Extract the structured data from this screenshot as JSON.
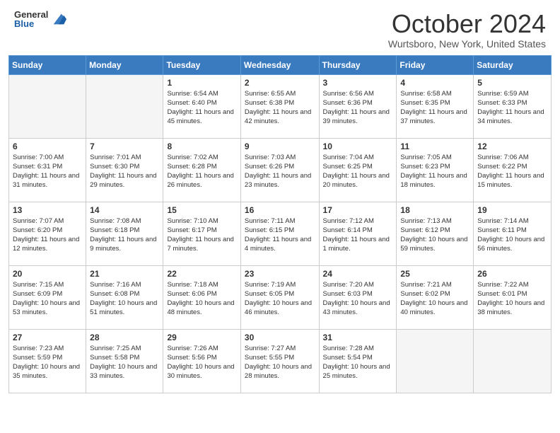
{
  "header": {
    "logo_general": "General",
    "logo_blue": "Blue",
    "title": "October 2024",
    "location": "Wurtsboro, New York, United States"
  },
  "days_of_week": [
    "Sunday",
    "Monday",
    "Tuesday",
    "Wednesday",
    "Thursday",
    "Friday",
    "Saturday"
  ],
  "weeks": [
    [
      {
        "day": "",
        "empty": true
      },
      {
        "day": "",
        "empty": true
      },
      {
        "day": "1",
        "sunrise": "Sunrise: 6:54 AM",
        "sunset": "Sunset: 6:40 PM",
        "daylight": "Daylight: 11 hours and 45 minutes."
      },
      {
        "day": "2",
        "sunrise": "Sunrise: 6:55 AM",
        "sunset": "Sunset: 6:38 PM",
        "daylight": "Daylight: 11 hours and 42 minutes."
      },
      {
        "day": "3",
        "sunrise": "Sunrise: 6:56 AM",
        "sunset": "Sunset: 6:36 PM",
        "daylight": "Daylight: 11 hours and 39 minutes."
      },
      {
        "day": "4",
        "sunrise": "Sunrise: 6:58 AM",
        "sunset": "Sunset: 6:35 PM",
        "daylight": "Daylight: 11 hours and 37 minutes."
      },
      {
        "day": "5",
        "sunrise": "Sunrise: 6:59 AM",
        "sunset": "Sunset: 6:33 PM",
        "daylight": "Daylight: 11 hours and 34 minutes."
      }
    ],
    [
      {
        "day": "6",
        "sunrise": "Sunrise: 7:00 AM",
        "sunset": "Sunset: 6:31 PM",
        "daylight": "Daylight: 11 hours and 31 minutes."
      },
      {
        "day": "7",
        "sunrise": "Sunrise: 7:01 AM",
        "sunset": "Sunset: 6:30 PM",
        "daylight": "Daylight: 11 hours and 29 minutes."
      },
      {
        "day": "8",
        "sunrise": "Sunrise: 7:02 AM",
        "sunset": "Sunset: 6:28 PM",
        "daylight": "Daylight: 11 hours and 26 minutes."
      },
      {
        "day": "9",
        "sunrise": "Sunrise: 7:03 AM",
        "sunset": "Sunset: 6:26 PM",
        "daylight": "Daylight: 11 hours and 23 minutes."
      },
      {
        "day": "10",
        "sunrise": "Sunrise: 7:04 AM",
        "sunset": "Sunset: 6:25 PM",
        "daylight": "Daylight: 11 hours and 20 minutes."
      },
      {
        "day": "11",
        "sunrise": "Sunrise: 7:05 AM",
        "sunset": "Sunset: 6:23 PM",
        "daylight": "Daylight: 11 hours and 18 minutes."
      },
      {
        "day": "12",
        "sunrise": "Sunrise: 7:06 AM",
        "sunset": "Sunset: 6:22 PM",
        "daylight": "Daylight: 11 hours and 15 minutes."
      }
    ],
    [
      {
        "day": "13",
        "sunrise": "Sunrise: 7:07 AM",
        "sunset": "Sunset: 6:20 PM",
        "daylight": "Daylight: 11 hours and 12 minutes."
      },
      {
        "day": "14",
        "sunrise": "Sunrise: 7:08 AM",
        "sunset": "Sunset: 6:18 PM",
        "daylight": "Daylight: 11 hours and 9 minutes."
      },
      {
        "day": "15",
        "sunrise": "Sunrise: 7:10 AM",
        "sunset": "Sunset: 6:17 PM",
        "daylight": "Daylight: 11 hours and 7 minutes."
      },
      {
        "day": "16",
        "sunrise": "Sunrise: 7:11 AM",
        "sunset": "Sunset: 6:15 PM",
        "daylight": "Daylight: 11 hours and 4 minutes."
      },
      {
        "day": "17",
        "sunrise": "Sunrise: 7:12 AM",
        "sunset": "Sunset: 6:14 PM",
        "daylight": "Daylight: 11 hours and 1 minute."
      },
      {
        "day": "18",
        "sunrise": "Sunrise: 7:13 AM",
        "sunset": "Sunset: 6:12 PM",
        "daylight": "Daylight: 10 hours and 59 minutes."
      },
      {
        "day": "19",
        "sunrise": "Sunrise: 7:14 AM",
        "sunset": "Sunset: 6:11 PM",
        "daylight": "Daylight: 10 hours and 56 minutes."
      }
    ],
    [
      {
        "day": "20",
        "sunrise": "Sunrise: 7:15 AM",
        "sunset": "Sunset: 6:09 PM",
        "daylight": "Daylight: 10 hours and 53 minutes."
      },
      {
        "day": "21",
        "sunrise": "Sunrise: 7:16 AM",
        "sunset": "Sunset: 6:08 PM",
        "daylight": "Daylight: 10 hours and 51 minutes."
      },
      {
        "day": "22",
        "sunrise": "Sunrise: 7:18 AM",
        "sunset": "Sunset: 6:06 PM",
        "daylight": "Daylight: 10 hours and 48 minutes."
      },
      {
        "day": "23",
        "sunrise": "Sunrise: 7:19 AM",
        "sunset": "Sunset: 6:05 PM",
        "daylight": "Daylight: 10 hours and 46 minutes."
      },
      {
        "day": "24",
        "sunrise": "Sunrise: 7:20 AM",
        "sunset": "Sunset: 6:03 PM",
        "daylight": "Daylight: 10 hours and 43 minutes."
      },
      {
        "day": "25",
        "sunrise": "Sunrise: 7:21 AM",
        "sunset": "Sunset: 6:02 PM",
        "daylight": "Daylight: 10 hours and 40 minutes."
      },
      {
        "day": "26",
        "sunrise": "Sunrise: 7:22 AM",
        "sunset": "Sunset: 6:01 PM",
        "daylight": "Daylight: 10 hours and 38 minutes."
      }
    ],
    [
      {
        "day": "27",
        "sunrise": "Sunrise: 7:23 AM",
        "sunset": "Sunset: 5:59 PM",
        "daylight": "Daylight: 10 hours and 35 minutes."
      },
      {
        "day": "28",
        "sunrise": "Sunrise: 7:25 AM",
        "sunset": "Sunset: 5:58 PM",
        "daylight": "Daylight: 10 hours and 33 minutes."
      },
      {
        "day": "29",
        "sunrise": "Sunrise: 7:26 AM",
        "sunset": "Sunset: 5:56 PM",
        "daylight": "Daylight: 10 hours and 30 minutes."
      },
      {
        "day": "30",
        "sunrise": "Sunrise: 7:27 AM",
        "sunset": "Sunset: 5:55 PM",
        "daylight": "Daylight: 10 hours and 28 minutes."
      },
      {
        "day": "31",
        "sunrise": "Sunrise: 7:28 AM",
        "sunset": "Sunset: 5:54 PM",
        "daylight": "Daylight: 10 hours and 25 minutes."
      },
      {
        "day": "",
        "empty": true
      },
      {
        "day": "",
        "empty": true
      }
    ]
  ]
}
